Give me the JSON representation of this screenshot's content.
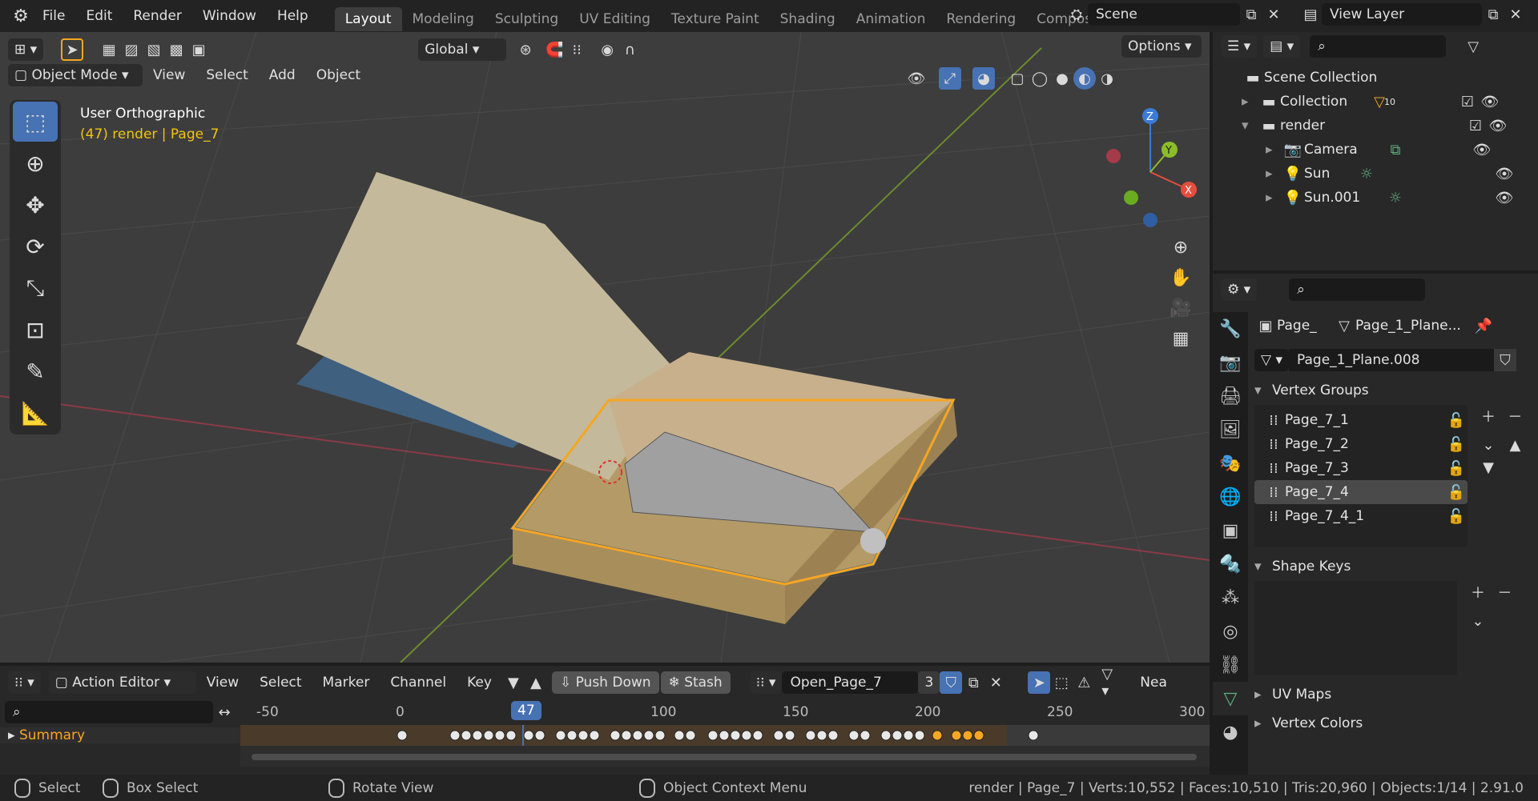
{
  "app": {
    "menu": [
      "File",
      "Edit",
      "Render",
      "Window",
      "Help"
    ]
  },
  "workspaces": [
    "Layout",
    "Modeling",
    "Sculpting",
    "UV Editing",
    "Texture Paint",
    "Shading",
    "Animation",
    "Rendering",
    "Compos"
  ],
  "scene": {
    "name": "Scene",
    "view_layer": "View Layer"
  },
  "viewport": {
    "mode": "Object Mode",
    "menus": [
      "View",
      "Select",
      "Add",
      "Object"
    ],
    "orientation": "Global",
    "options_label": "Options",
    "view_name": "User Orthographic",
    "object_info": "(47) render | Page_7",
    "axis_labels": {
      "x": "X",
      "y": "Y",
      "z": "Z"
    }
  },
  "outliner": {
    "root": "Scene Collection",
    "items": [
      {
        "label": "Collection",
        "badge": "10"
      },
      {
        "label": "render"
      },
      {
        "label": "Camera"
      },
      {
        "label": "Sun"
      },
      {
        "label": "Sun.001"
      }
    ]
  },
  "properties": {
    "breadcrumb_object": "Page_",
    "breadcrumb_mesh": "Page_1_Plane...",
    "mesh_name": "Page_1_Plane.008",
    "vertex_groups_label": "Vertex Groups",
    "vertex_groups": [
      "Page_7_1",
      "Page_7_2",
      "Page_7_3",
      "Page_7_4",
      "Page_7_4_1"
    ],
    "selected_group": "Page_7_4",
    "shape_keys_label": "Shape Keys",
    "uv_maps_label": "UV Maps",
    "vertex_colors_label": "Vertex Colors"
  },
  "timeline": {
    "editor": "Action Editor",
    "menus": [
      "View",
      "Select",
      "Marker",
      "Channel",
      "Key"
    ],
    "push_down": "Push Down",
    "stash": "Stash",
    "action": "Open_Page_7",
    "users": "3",
    "nearest": "Nea",
    "ticks": [
      "-50",
      "0",
      "47",
      "100",
      "150",
      "200",
      "250",
      "300"
    ],
    "current_frame": "47",
    "summary": "Summary"
  },
  "status": {
    "select": "Select",
    "box_select": "Box Select",
    "rotate_view": "Rotate View",
    "context_menu": "Object Context Menu",
    "stats": "render | Page_7 | Verts:10,552 | Faces:10,510 | Tris:20,960 | Objects:1/14 | 2.91.0"
  },
  "colors": {
    "accent": "#4772b3",
    "selection": "#f5a623",
    "keyframe": "#e0e0e0"
  }
}
